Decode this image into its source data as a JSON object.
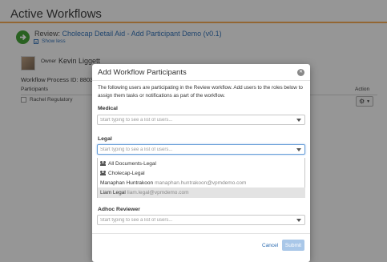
{
  "page": {
    "title": "Active Workflows",
    "review_prefix": "Review:",
    "review_link": "Cholecap Detail Aid - Add Participant Demo (v0.1)",
    "show_less": "Show less",
    "owner_label": "Owner",
    "owner_name": "Kevin Liggett",
    "workflow_id_label": "Workflow Process ID: 8803",
    "participants_header": "Participants",
    "participant_name": "Rachel Regulatory",
    "action_header": "Action",
    "action_icon": "gear-icon"
  },
  "modal": {
    "title": "Add Workflow Participants",
    "description": "The following users are participating in the Review workflow.  Add users to the roles below to assign them tasks or notifications as part of the workflow.",
    "roles": [
      {
        "label": "Medical",
        "placeholder": "Start typing to see a list of users..."
      },
      {
        "label": "Legal",
        "placeholder": "Start typing to see a list of users..."
      },
      {
        "label": "Adhoc Reviewer",
        "placeholder": "Start typing to see a list of users..."
      }
    ],
    "dropdown": [
      {
        "name": "All Documents-Legal",
        "email": "",
        "icon": "group-icon"
      },
      {
        "name": "Cholecap-Legal",
        "email": "",
        "icon": "group-icon"
      },
      {
        "name": "Manaphan Huntrakoon",
        "email": "manaphan.huntrakoon@vpmdemo.com",
        "icon": ""
      },
      {
        "name": "Liam Legal",
        "email": "liam.legal@vpmdemo.com",
        "icon": ""
      }
    ],
    "cancel_label": "Cancel",
    "submit_label": "Submit",
    "close_icon": "close-icon"
  }
}
